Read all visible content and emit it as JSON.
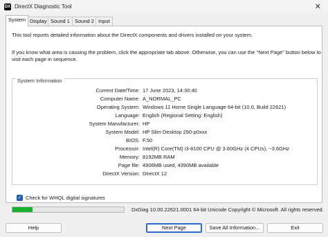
{
  "window": {
    "title": "DirectX Diagnostic Tool",
    "close_glyph": "✕",
    "icon_glyph": "DX"
  },
  "tabs": [
    {
      "label": "System",
      "active": true
    },
    {
      "label": "Display"
    },
    {
      "label": "Sound 1"
    },
    {
      "label": "Sound 2"
    },
    {
      "label": "Input"
    }
  ],
  "intro": {
    "line1": "This tool reports detailed information about the DirectX components and drivers installed on your system.",
    "line2": "If you know what area is causing the problem, click the appropriate tab above.  Otherwise, you can use the \"Next Page\" button below to",
    "line3": "visit each page in sequence."
  },
  "system_information": {
    "heading": "System Information",
    "rows": [
      {
        "label": "Current Date/Time:",
        "value": "17 June 2023, 14:30:40"
      },
      {
        "label": "Computer Name:",
        "value": "A_NORMAL_PC"
      },
      {
        "label": "Operating System:",
        "value": "Windows 11 Home Single Language 64-bit (10.0, Build 22621)"
      },
      {
        "label": "Language:",
        "value": "English (Regional Setting: English)"
      },
      {
        "label": "System Manufacturer:",
        "value": "HP"
      },
      {
        "label": "System Model:",
        "value": "HP Slim Desktop 290-p0xxx"
      },
      {
        "label": "BIOS:",
        "value": "F.50"
      },
      {
        "label": "Processor:",
        "value": "Intel(R) Core(TM) i3-8100 CPU @ 3.60GHz (4 CPUs), ~3.6GHz"
      },
      {
        "label": "Memory:",
        "value": "8192MB RAM"
      },
      {
        "label": "Page file:",
        "value": "4906MB used, 4390MB available"
      },
      {
        "label": "DirectX Version:",
        "value": "DirectX 12"
      }
    ]
  },
  "whql": {
    "label": "Check for WHQL digital signatures",
    "checked": true,
    "check_glyph": "✓"
  },
  "progress": {
    "fraction": 0.18,
    "color": "#16b12e"
  },
  "status_text": "DxDiag 10.00.22621.0001 64-bit Unicode  Copyright © Microsoft. All rights reserved.",
  "buttons": {
    "help": "Help",
    "next_page": "Next Page",
    "save_all": "Save All Information...",
    "exit": "Exit"
  }
}
